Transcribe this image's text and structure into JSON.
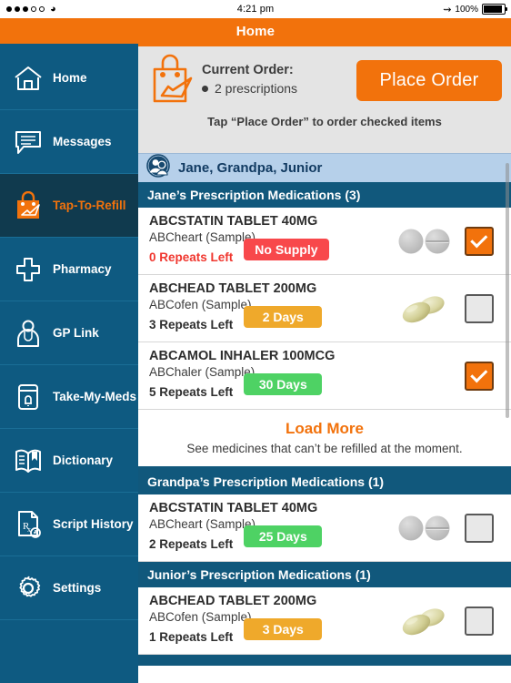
{
  "statusbar": {
    "time": "4:21 pm",
    "battery_pct": "100%",
    "wifi_icon": "wifi-icon",
    "bluetooth_icon": "bluetooth-icon",
    "battery_icon": "battery-full-icon"
  },
  "titlebar": {
    "title": "Home"
  },
  "sidebar": {
    "items": [
      {
        "label": "Home",
        "icon": "house-icon",
        "active": false
      },
      {
        "label": "Messages",
        "icon": "speech-bubble-icon",
        "active": false
      },
      {
        "label": "Tap-To-Refill",
        "icon": "shopping-bag-icon",
        "active": true
      },
      {
        "label": "Pharmacy",
        "icon": "cross-icon",
        "active": false
      },
      {
        "label": "GP Link",
        "icon": "doctor-icon",
        "active": false
      },
      {
        "label": "Take-My-Meds",
        "icon": "pill-bottle-alarm-icon",
        "active": false
      },
      {
        "label": "Dictionary",
        "icon": "open-book-icon",
        "active": false
      },
      {
        "label": "Script History",
        "icon": "rx-document-icon",
        "active": false
      },
      {
        "label": "Settings",
        "icon": "gear-icon",
        "active": false
      }
    ]
  },
  "order_panel": {
    "icon": "shopping-bag-check-icon",
    "title": "Current Order:",
    "subtitle": "2 prescriptions",
    "place_order_label": "Place Order",
    "hint": "Tap “Place Order” to order checked items"
  },
  "patient_selector": {
    "icon": "people-group-icon",
    "names": "Jane, Grandpa, Junior"
  },
  "sections": [
    {
      "header": "Jane’s Prescription Medications (3)",
      "meds": [
        {
          "name": "ABCSTATIN TABLET 40MG",
          "brand": "ABCheart (Sample)",
          "repeats": "0 Repeats Left",
          "repeats_state": "danger",
          "supply": "No Supply",
          "supply_state": "red",
          "pill": "round-grey-tablets",
          "checked": true
        },
        {
          "name": "ABCHEAD TABLET 200MG",
          "brand": "ABCofen (Sample)",
          "repeats": "3 Repeats Left",
          "repeats_state": "normal",
          "supply": "2 Days",
          "supply_state": "amber",
          "pill": "oval-tan-capsules",
          "checked": false
        },
        {
          "name": "ABCAMOL INHALER 100MCG",
          "brand": "ABChaler (Sample)",
          "repeats": "5 Repeats Left",
          "repeats_state": "normal",
          "supply": "30 Days",
          "supply_state": "green",
          "pill": "none",
          "checked": true
        }
      ],
      "load_more": {
        "link": "Load More",
        "subtext": "See medicines that can’t be refilled at the moment."
      }
    },
    {
      "header": "Grandpa’s Prescription Medications (1)",
      "meds": [
        {
          "name": "ABCSTATIN TABLET 40MG",
          "brand": "ABCheart (Sample)",
          "repeats": "2 Repeats Left",
          "repeats_state": "normal",
          "supply": "25 Days",
          "supply_state": "green",
          "pill": "round-grey-tablets",
          "checked": false
        }
      ]
    },
    {
      "header": "Junior’s Prescription Medications (1)",
      "meds": [
        {
          "name": "ABCHEAD TABLET 200MG",
          "brand": "ABCofen (Sample)",
          "repeats": "1 Repeats Left",
          "repeats_state": "normal",
          "supply": "3 Days",
          "supply_state": "amber",
          "pill": "oval-tan-capsules",
          "checked": false
        }
      ]
    }
  ],
  "colors": {
    "brand_orange": "#F2720C",
    "sidebar_blue": "#0E5A81",
    "sidebar_active": "#103A4E",
    "section_header": "#11587C",
    "patient_band": "#B6D0EA",
    "supply_red": "#F8484B",
    "supply_amber": "#EFA92B",
    "supply_green": "#4ED264",
    "repeats_danger": "#F0372F"
  }
}
